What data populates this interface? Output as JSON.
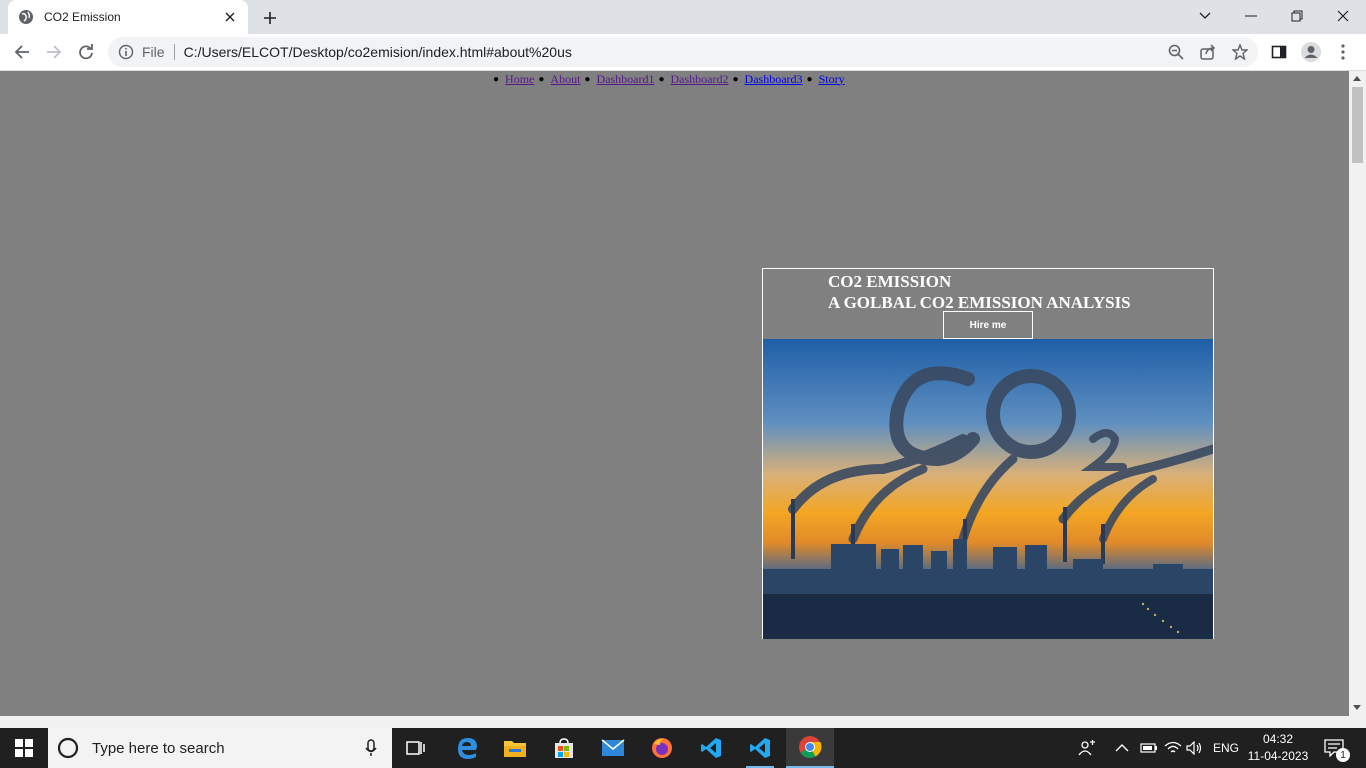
{
  "browser": {
    "tab_title": "CO2 Emission",
    "scheme_label": "File",
    "url": "C:/Users/ELCOT/Desktop/co2emision/index.html#about%20us"
  },
  "page": {
    "menu": [
      {
        "label": "Home"
      },
      {
        "label": "About"
      },
      {
        "label": "Dashboard1"
      },
      {
        "label": "Dashboard2"
      },
      {
        "label": "Dashboard3"
      },
      {
        "label": "Story"
      }
    ],
    "hero_line1": "CO2 EMISSION",
    "hero_line2": "A GOLBAL CO2 EMISSION ANALYSIS",
    "hire_button": "Hire me"
  },
  "taskbar": {
    "search_placeholder": "Type here to search",
    "language": "ENG",
    "time": "04:32",
    "date": "11-04-2023",
    "notification_count": "1"
  },
  "colors": {
    "page_background": "#808080",
    "visited_link": "#551a8b",
    "unvisited_link": "#0000ee"
  }
}
